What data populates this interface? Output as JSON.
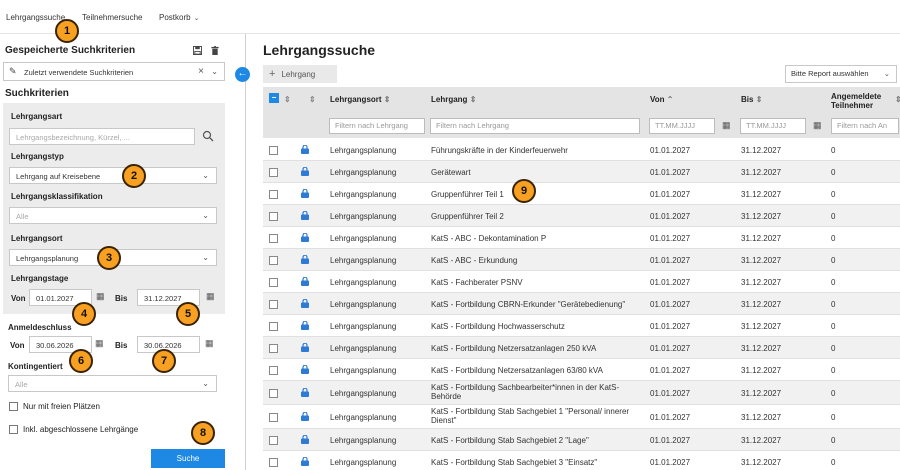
{
  "topnav": {
    "items": [
      {
        "label": "Lehrgangssuche"
      },
      {
        "label": "Teilnehmersuche"
      },
      {
        "label": "Postkorb",
        "has_dropdown": true
      }
    ]
  },
  "icons": {
    "save": "floppy-disk-icon",
    "delete": "trash-icon",
    "chevron": "⌄",
    "calendar": "▦",
    "search": "⌕"
  },
  "colors": {
    "accent": "#1e88e5",
    "badge": "#f7a022",
    "lock": "#2e7bd6"
  },
  "saved": {
    "title": "Gespeicherte Suchkriterien",
    "select_value": "Zuletzt verwendete Suchkriterien"
  },
  "criteria": {
    "title": "Suchkriterien",
    "lehrgangsart": {
      "label": "Lehrgangsart",
      "placeholder": "Lehrgangsbezeichnung, Kürzel, ..."
    },
    "lehrgangstyp": {
      "label": "Lehrgangstyp",
      "value": "Lehrgang auf Kreisebene"
    },
    "klassifikation": {
      "label": "Lehrgangsklassifikation",
      "value": "Alle"
    },
    "ort": {
      "label": "Lehrgangsort",
      "value": "Lehrgangsplanung"
    },
    "tage": {
      "label": "Lehrgangstage",
      "von_label": "Von",
      "von": "01.01.2027",
      "bis_label": "Bis",
      "bis": "31.12.2027"
    },
    "anmeldeschluss": {
      "label": "Anmeldeschluss",
      "von_label": "Von",
      "von": "30.06.2026",
      "bis_label": "Bis",
      "bis": "30.06.2026"
    },
    "kontingentiert": {
      "label": "Kontingentiert",
      "value": "Alle"
    },
    "nur_freie": {
      "label": "Nur mit freien Plätzen",
      "checked": false
    },
    "inkl_abgeschlossen": {
      "label": "Inkl. abgeschlossene Lehrgänge",
      "checked": false
    },
    "search_button": "Suche"
  },
  "badges": [
    "1",
    "2",
    "3",
    "4",
    "5",
    "6",
    "7",
    "8",
    "9"
  ],
  "main": {
    "title": "Lehrgangssuche",
    "add_button": "Lehrgang",
    "report_select": "Bitte Report auswählen",
    "columns": {
      "ort": "Lehrgangsort",
      "lehrgang": "Lehrgang",
      "von": "Von",
      "bis": "Bis",
      "angemeldete_1": "Angemeldete",
      "angemeldete_2": "Teilnehmer"
    },
    "filters": {
      "ort": "Filtern nach Lehrgang",
      "lehrgang": "Filtern nach Lehrgang",
      "von": "TT.MM.JJJJ",
      "bis": "TT.MM.JJJJ",
      "angemeldete": "Filtern nach An"
    },
    "rows": [
      {
        "ort": "Lehrgangsplanung",
        "lehrgang": "Führungskräfte in der Kinderfeuerwehr",
        "von": "01.01.2027",
        "bis": "31.12.2027",
        "n": "0"
      },
      {
        "ort": "Lehrgangsplanung",
        "lehrgang": "Gerätewart",
        "von": "01.01.2027",
        "bis": "31.12.2027",
        "n": "0"
      },
      {
        "ort": "Lehrgangsplanung",
        "lehrgang": "Gruppenführer Teil 1",
        "von": "01.01.2027",
        "bis": "31.12.2027",
        "n": "0"
      },
      {
        "ort": "Lehrgangsplanung",
        "lehrgang": "Gruppenführer Teil 2",
        "von": "01.01.2027",
        "bis": "31.12.2027",
        "n": "0"
      },
      {
        "ort": "Lehrgangsplanung",
        "lehrgang": "KatS - ABC - Dekontamination P",
        "von": "01.01.2027",
        "bis": "31.12.2027",
        "n": "0"
      },
      {
        "ort": "Lehrgangsplanung",
        "lehrgang": "KatS - ABC - Erkundung",
        "von": "01.01.2027",
        "bis": "31.12.2027",
        "n": "0"
      },
      {
        "ort": "Lehrgangsplanung",
        "lehrgang": "KatS - Fachberater PSNV",
        "von": "01.01.2027",
        "bis": "31.12.2027",
        "n": "0"
      },
      {
        "ort": "Lehrgangsplanung",
        "lehrgang": "KatS - Fortbildung CBRN-Erkunder \"Gerätebedienung\"",
        "von": "01.01.2027",
        "bis": "31.12.2027",
        "n": "0"
      },
      {
        "ort": "Lehrgangsplanung",
        "lehrgang": "KatS - Fortbildung Hochwasserschutz",
        "von": "01.01.2027",
        "bis": "31.12.2027",
        "n": "0"
      },
      {
        "ort": "Lehrgangsplanung",
        "lehrgang": "KatS - Fortbildung Netzersatzanlagen 250 kVA",
        "von": "01.01.2027",
        "bis": "31.12.2027",
        "n": "0"
      },
      {
        "ort": "Lehrgangsplanung",
        "lehrgang": "KatS - Fortbildung Netzersatzanlagen 63/80 kVA",
        "von": "01.01.2027",
        "bis": "31.12.2027",
        "n": "0"
      },
      {
        "ort": "Lehrgangsplanung",
        "lehrgang": "KatS - Fortbildung Sachbearbeiter*innen in der KatS-Behörde",
        "von": "01.01.2027",
        "bis": "31.12.2027",
        "n": "0"
      },
      {
        "ort": "Lehrgangsplanung",
        "lehrgang": "KatS - Fortbildung Stab Sachgebiet 1 \"Personal/ innerer Dienst\"",
        "von": "01.01.2027",
        "bis": "31.12.2027",
        "n": "0"
      },
      {
        "ort": "Lehrgangsplanung",
        "lehrgang": "KatS - Fortbildung Stab Sachgebiet 2 \"Lage\"",
        "von": "01.01.2027",
        "bis": "31.12.2027",
        "n": "0"
      },
      {
        "ort": "Lehrgangsplanung",
        "lehrgang": "KatS - Fortbildung Stab Sachgebiet 3 \"Einsatz\"",
        "von": "01.01.2027",
        "bis": "31.12.2027",
        "n": "0"
      }
    ]
  }
}
